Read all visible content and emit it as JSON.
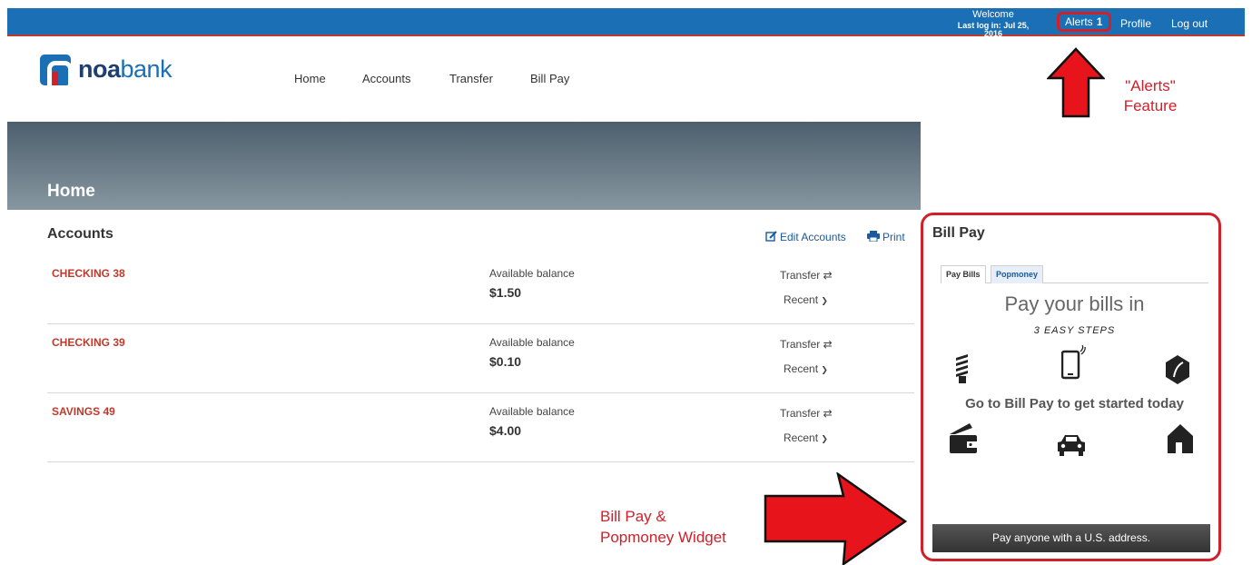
{
  "topbar": {
    "welcome": "Welcome",
    "last_login": "Last log in: Jul 25, 2016",
    "alerts_label": "Alerts",
    "alerts_count": "1",
    "profile": "Profile",
    "logout": "Log out"
  },
  "brand": {
    "bold": "noa",
    "light": "bank"
  },
  "nav": [
    "Home",
    "Accounts",
    "Transfer",
    "Bill Pay"
  ],
  "banner": {
    "title": "Home"
  },
  "accounts": {
    "title": "Accounts",
    "edit_label": "Edit Accounts",
    "print_label": "Print",
    "rows": [
      {
        "name": "CHECKING 38",
        "balance_label": "Available balance",
        "amount": "$1.50",
        "transfer": "Transfer",
        "recent": "Recent"
      },
      {
        "name": "CHECKING 39",
        "balance_label": "Available balance",
        "amount": "$0.10",
        "transfer": "Transfer",
        "recent": "Recent"
      },
      {
        "name": "SAVINGS 49",
        "balance_label": "Available balance",
        "amount": "$4.00",
        "transfer": "Transfer",
        "recent": "Recent"
      }
    ]
  },
  "billpay": {
    "title": "Bill Pay",
    "tabs": [
      "Pay Bills",
      "Popmoney"
    ],
    "headline": "Pay your bills in",
    "subline": "3 EASY STEPS",
    "cta": "Go to Bill Pay to get started today",
    "footer": "Pay anyone with a U.S. address.",
    "icons": [
      "lightbulb-icon",
      "tablet-icon",
      "leaf-icon",
      "wallet-icon",
      "car-icon",
      "house-icon"
    ]
  },
  "annotations": {
    "alerts_line1": "\"Alerts\"",
    "alerts_line2": "Feature",
    "billpay_line1": "Bill Pay &",
    "billpay_line2": "Popmoney Widget"
  },
  "colors": {
    "brand_blue": "#1a6fb5",
    "accent_red": "#d0202a",
    "account_red": "#c0392b"
  }
}
